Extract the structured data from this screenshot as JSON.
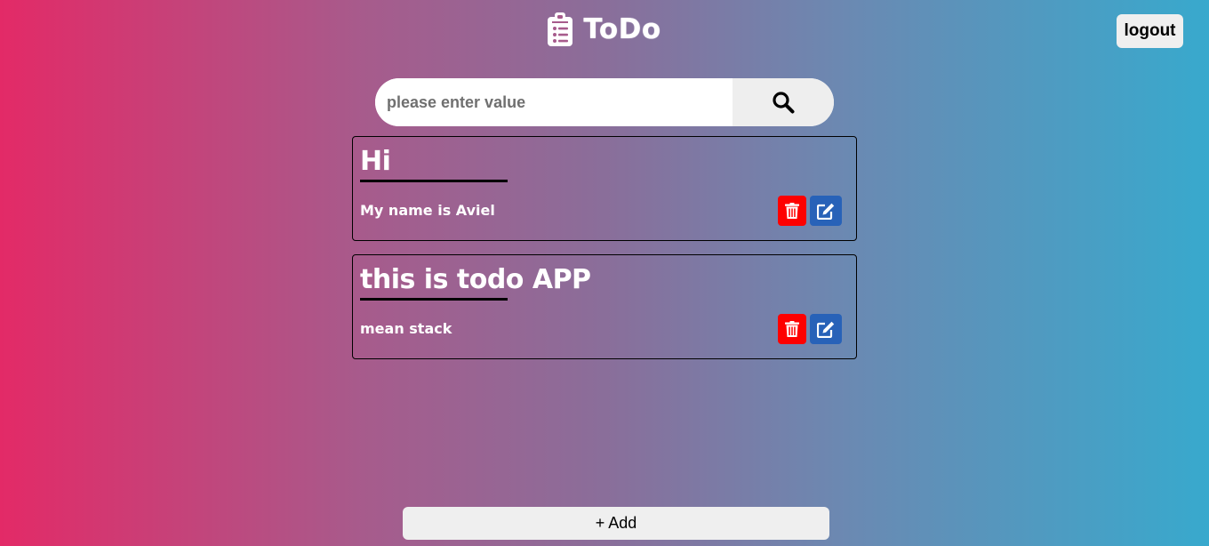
{
  "header": {
    "title": "ToDo",
    "logout_label": "logout"
  },
  "search": {
    "placeholder": "please enter value",
    "value": ""
  },
  "todos": [
    {
      "title": "Hi",
      "description": "My name is Aviel"
    },
    {
      "title": "this is todo APP",
      "description": "mean stack"
    }
  ],
  "add_label": "+ Add",
  "colors": {
    "gradient_start": "#e32a67",
    "gradient_end": "#38a9cd",
    "delete": "#fe0000",
    "edit": "#2862b8",
    "button_bg": "#efefef"
  },
  "icons": {
    "brand": "clipboard-list-icon",
    "search": "search-icon",
    "delete": "trash-icon",
    "edit": "edit-icon"
  }
}
